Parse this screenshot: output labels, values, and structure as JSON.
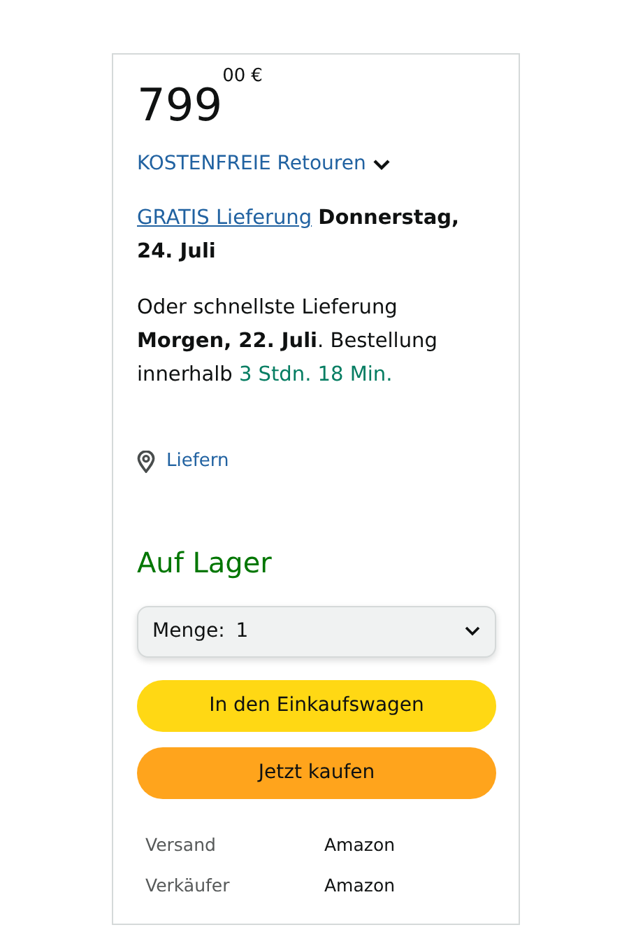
{
  "price": {
    "whole": "799",
    "fraction": "00",
    "currency": "€"
  },
  "returns": {
    "label": "KOSTENFREIE Retouren"
  },
  "delivery": {
    "link": "GRATIS Lieferung",
    "text": "**Donnerstag, 24. Juli**"
  },
  "fastest": {
    "text": "Oder schnellste Lieferung **Morgen, 22. Juli**. Bestellung innerhalb",
    "countdown": "3 Stdn. 18 Min."
  },
  "location": {
    "label": "Liefern"
  },
  "stock": "Auf Lager",
  "quantity": {
    "label": "Menge:",
    "value": "1"
  },
  "buttons": [
    {
      "label": "In den Einkaufswagen",
      "kind": "cart"
    },
    {
      "label": "Jetzt kaufen",
      "kind": "buy"
    }
  ],
  "details": [
    {
      "label": "Versand",
      "value": "Amazon"
    },
    {
      "label": "Verkäufer",
      "value": "Amazon"
    }
  ]
}
